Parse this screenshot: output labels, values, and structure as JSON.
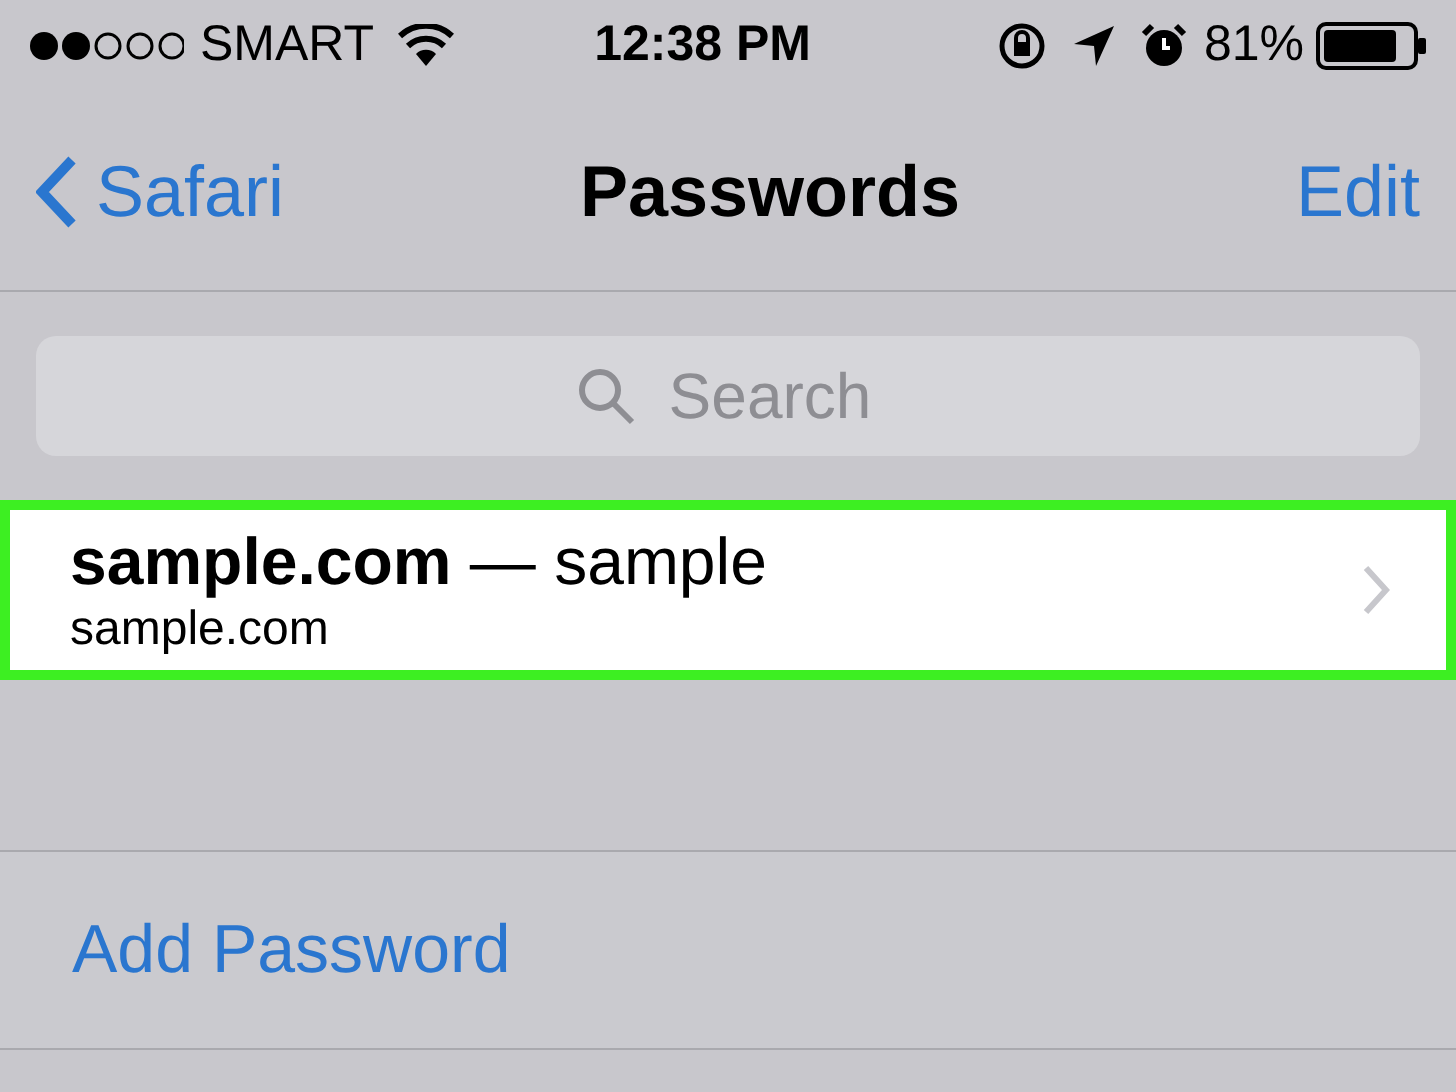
{
  "status_bar": {
    "carrier": "SMART",
    "time": "12:38 PM",
    "battery": "81%"
  },
  "nav_bar": {
    "back": "Safari",
    "title": "Passwords",
    "action": "Edit"
  },
  "search": {
    "placeholder": "Search"
  },
  "passwords": [
    {
      "title": "**sample.com** — sample",
      "url": "sample.com",
      "highlighted": true
    }
  ],
  "add_button": "Add Password"
}
